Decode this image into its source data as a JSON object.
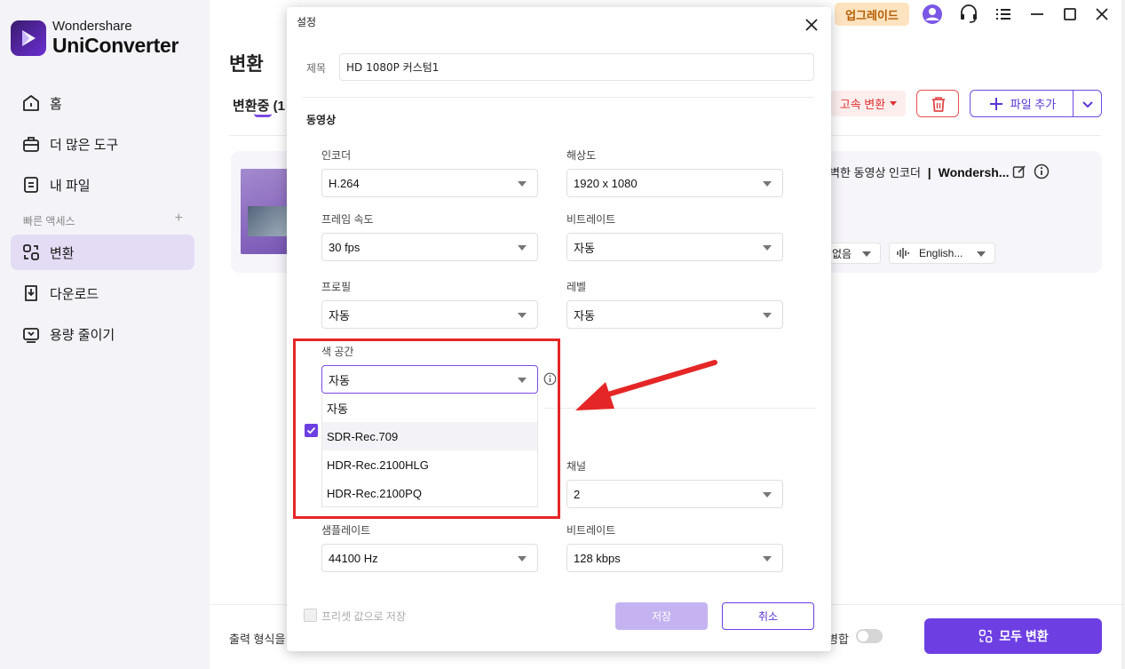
{
  "brand": {
    "top": "Wondershare",
    "bottom": "UniConverter"
  },
  "sidebar": {
    "items": [
      {
        "label": "홈",
        "icon": "home-icon"
      },
      {
        "label": "더 많은 도구",
        "icon": "toolbox-icon"
      },
      {
        "label": "내 파일",
        "icon": "file-icon"
      }
    ],
    "quick_access_label": "빠른 액세스",
    "quick_add": "+",
    "tools": [
      {
        "label": "변환",
        "icon": "convert-icon",
        "active": true
      },
      {
        "label": "다운로드",
        "icon": "download-icon"
      },
      {
        "label": "용량 줄이기",
        "icon": "compress-icon"
      }
    ]
  },
  "titlebar": {
    "upgrade_label": "업그레이드"
  },
  "main": {
    "page_title": "변환",
    "tab_label": "변환중 (1",
    "fast_convert_label": "고속 변환",
    "add_file_label": "파일 추가",
    "card": {
      "title_prefix": "벽한 동영상 인코더",
      "title_bold": "Wondersh...",
      "subtitle_option": "없음",
      "audio_option": "English..."
    },
    "output_format_label": "출력 형식을",
    "merge_label": "병합",
    "convert_all_label": "모두 변환"
  },
  "dialog": {
    "title": "설정",
    "name_label": "제목",
    "name_value": "HD 1080P 커스텀1",
    "video_section": "동영상",
    "encoder_label": "인코더",
    "encoder_value": "H.264",
    "resolution_label": "해상도",
    "resolution_value": "1920 x 1080",
    "framerate_label": "프레임 속도",
    "framerate_value": "30 fps",
    "bitrate_label": "비트레이트",
    "bitrate_value": "자동",
    "profile_label": "프로필",
    "profile_value": "자동",
    "level_label": "레벨",
    "level_value": "자동",
    "colorspace_label": "색 공간",
    "colorspace_value": "자동",
    "colorspace_options": [
      "자동",
      "SDR-Rec.709",
      "HDR-Rec.2100HLG",
      "HDR-Rec.2100PQ"
    ],
    "colorspace_selected": "SDR-Rec.709",
    "channel_label": "채널",
    "channel_value": "2",
    "samplerate_label": "샘플레이트",
    "samplerate_value": "44100 Hz",
    "audio_bitrate_label": "비트레이트",
    "audio_bitrate_value": "128 kbps",
    "preset_label": "프리셋 값으로 저장",
    "save_label": "저장",
    "cancel_label": "취소"
  },
  "colors": {
    "accent": "#6d3fe3",
    "annotation": "#e52626",
    "upgrade_bg": "#fde3bf"
  }
}
